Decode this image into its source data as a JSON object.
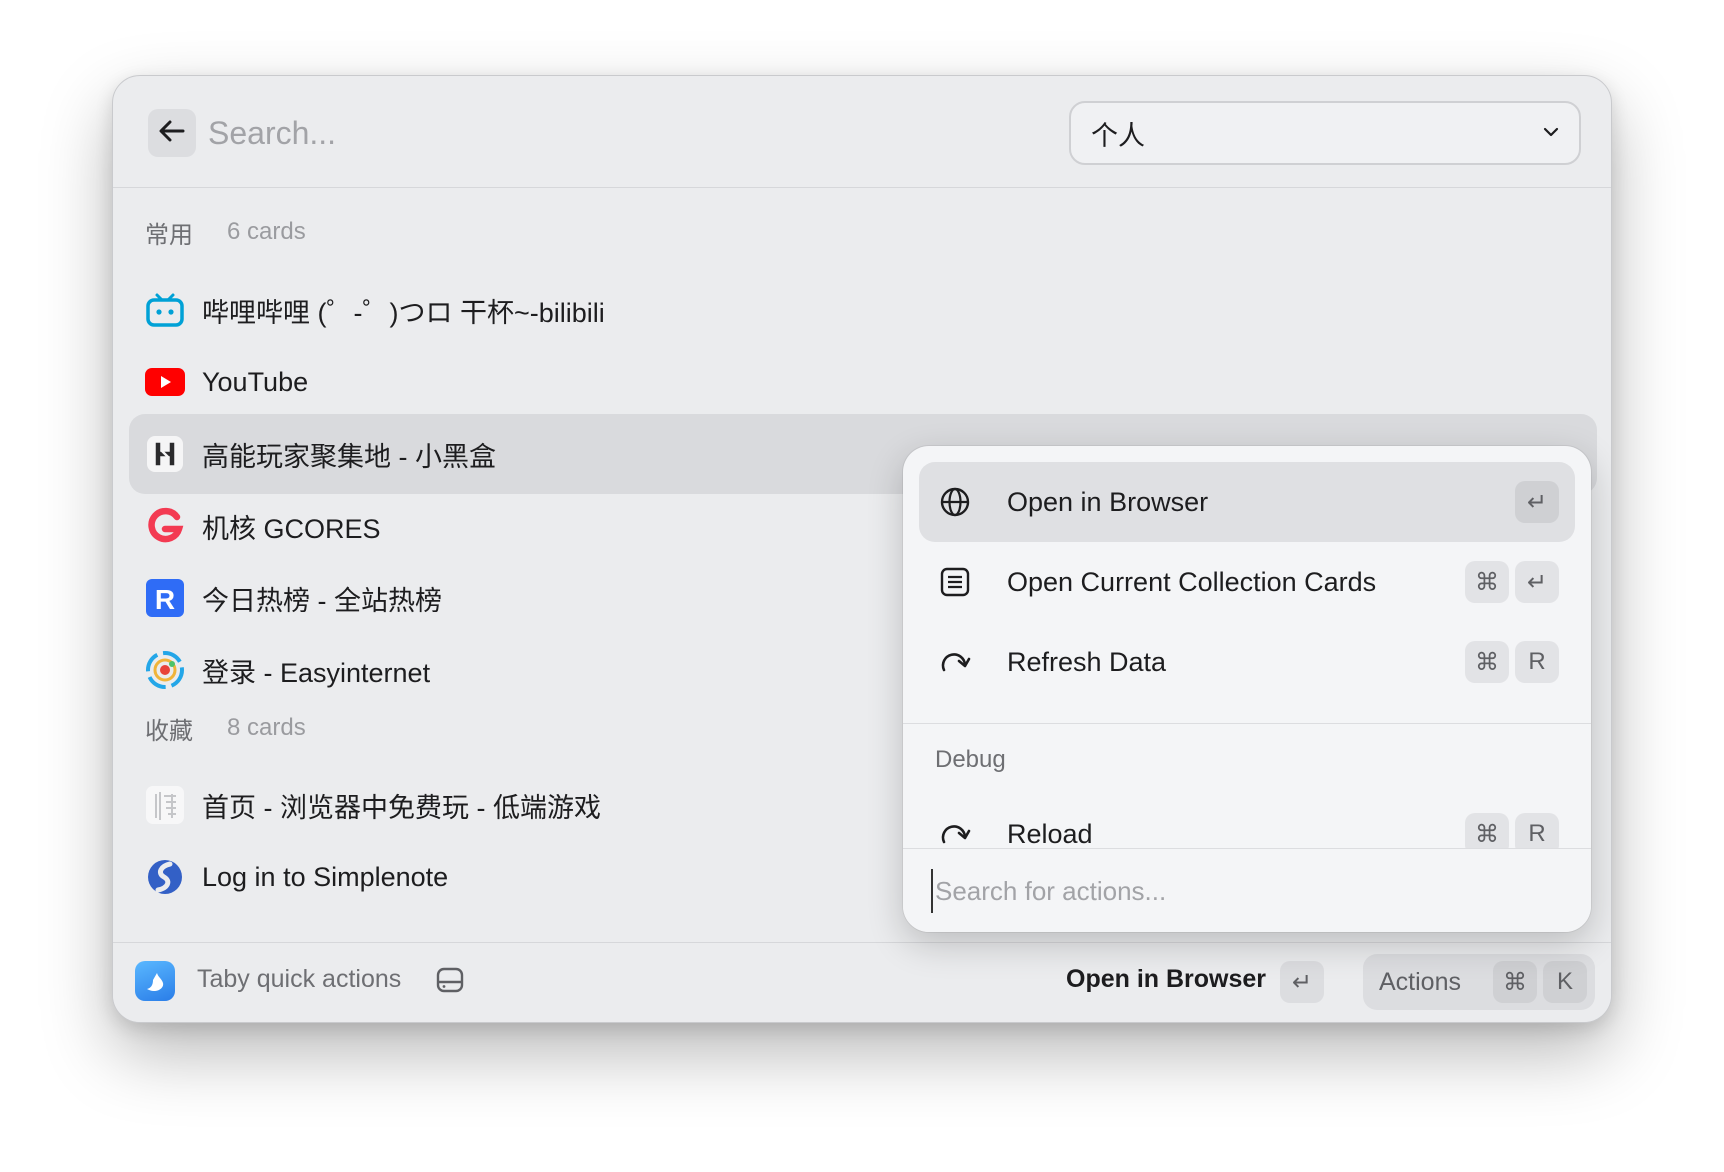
{
  "header": {
    "search_placeholder": "Search...",
    "collection_select": {
      "value": "个人"
    }
  },
  "sections": [
    {
      "title": "常用",
      "count": "6 cards",
      "items": [
        {
          "label": "哔哩哔哩 (゜-゜)つロ 干杯~-bilibili",
          "icon": "bilibili-icon"
        },
        {
          "label": "YouTube",
          "icon": "youtube-icon"
        },
        {
          "label": "高能玩家聚集地 - 小黑盒",
          "icon": "xiaoheihe-icon",
          "selected": true
        },
        {
          "label": "机核 GCORES",
          "icon": "gcores-icon"
        },
        {
          "label": "今日热榜 - 全站热榜",
          "icon": "tophub-icon"
        },
        {
          "label": "登录 - Easyinternet",
          "icon": "easyinternet-icon"
        }
      ]
    },
    {
      "title": "收藏",
      "count": "8 cards",
      "items": [
        {
          "label": "首页 - 浏览器中免费玩 - 低端游戏",
          "icon": "lowend-games-icon"
        },
        {
          "label": "Log in to Simplenote",
          "icon": "simplenote-icon"
        }
      ]
    }
  ],
  "footer": {
    "app_title": "Taby quick actions",
    "primary_action": "Open in Browser",
    "enter_key": "↵",
    "actions_label": "Actions",
    "actions_keys": [
      "⌘",
      "K"
    ]
  },
  "actions_popup": {
    "items": [
      {
        "label": "Open in Browser",
        "icon": "globe-icon",
        "keys": [
          "↵"
        ],
        "selected": true
      },
      {
        "label": "Open Current Collection Cards",
        "icon": "list-icon",
        "keys": [
          "⌘",
          "↵"
        ]
      },
      {
        "label": "Refresh Data",
        "icon": "refresh-icon",
        "keys": [
          "⌘",
          "R"
        ]
      }
    ],
    "debug_section": {
      "title": "Debug",
      "items": [
        {
          "label": "Reload",
          "icon": "reload-icon",
          "keys": [
            "⌘",
            "R"
          ]
        }
      ]
    },
    "search_placeholder": "Search for actions..."
  },
  "colors": {
    "window_bg": "#ebecee",
    "selected_row": "#d9dadd",
    "popup_bg": "#f4f5f7",
    "bilibili": "#00a1d6",
    "youtube": "#ff0000",
    "gcores": "#f33a52",
    "tophub": "#2f6cf6"
  }
}
